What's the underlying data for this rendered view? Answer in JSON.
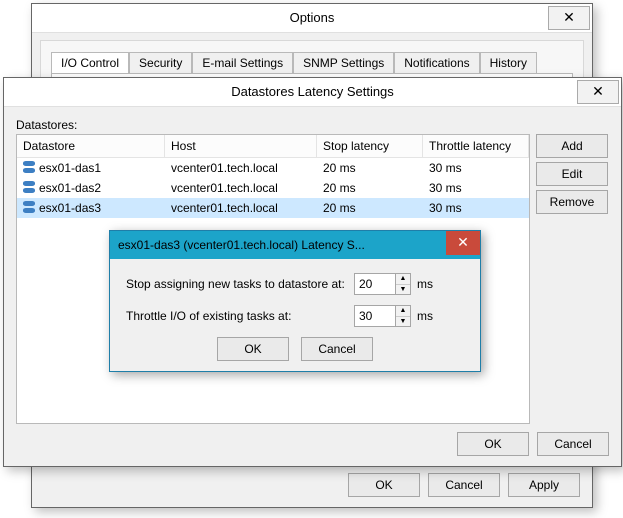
{
  "options": {
    "title": "Options",
    "tabs": [
      "I/O Control",
      "Security",
      "E-mail Settings",
      "SNMP Settings",
      "Notifications",
      "History"
    ],
    "buttons": {
      "ok": "OK",
      "cancel": "Cancel",
      "apply": "Apply"
    }
  },
  "latency": {
    "title": "Datastores Latency Settings",
    "list_label": "Datastores:",
    "columns": [
      "Datastore",
      "Host",
      "Stop latency",
      "Throttle latency"
    ],
    "rows": [
      {
        "datastore": "esx01-das1",
        "host": "vcenter01.tech.local",
        "stop": "20 ms",
        "throttle": "30 ms"
      },
      {
        "datastore": "esx01-das2",
        "host": "vcenter01.tech.local",
        "stop": "20 ms",
        "throttle": "30 ms"
      },
      {
        "datastore": "esx01-das3",
        "host": "vcenter01.tech.local",
        "stop": "20 ms",
        "throttle": "30 ms"
      }
    ],
    "selected_index": 2,
    "side": {
      "add": "Add",
      "edit": "Edit",
      "remove": "Remove"
    },
    "buttons": {
      "ok": "OK",
      "cancel": "Cancel"
    }
  },
  "modal": {
    "title": "esx01-das3 (vcenter01.tech.local) Latency S...",
    "stop_label": "Stop assigning new tasks to datastore at:",
    "throttle_label": "Throttle I/O of existing tasks at:",
    "stop_value": "20",
    "throttle_value": "30",
    "unit": "ms",
    "buttons": {
      "ok": "OK",
      "cancel": "Cancel"
    }
  }
}
